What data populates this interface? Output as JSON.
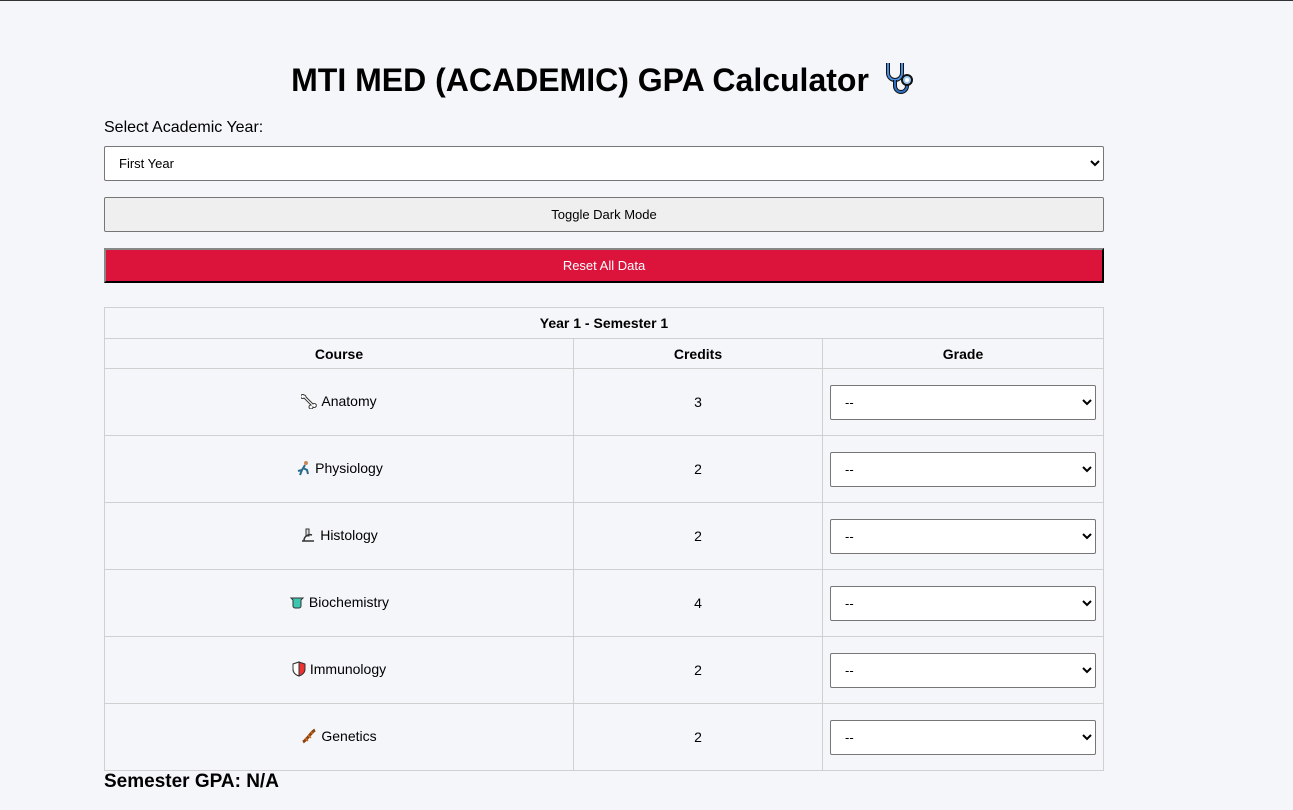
{
  "title": "MTI MED (ACADEMIC) GPA Calculator",
  "title_icon": "stethoscope-icon",
  "year_select": {
    "label": "Select Academic Year:",
    "selected": "First Year"
  },
  "buttons": {
    "toggle_dark_mode": "Toggle Dark Mode",
    "reset_all": "Reset All Data",
    "reset_color": "#dc143c"
  },
  "semester": {
    "title": "Year 1 - Semester 1",
    "columns": [
      "Course",
      "Credits",
      "Grade"
    ],
    "courses": [
      {
        "name": "Anatomy",
        "icon": "bone-icon",
        "credits": "3",
        "grade": "--"
      },
      {
        "name": "Physiology",
        "icon": "running-figure-icon",
        "credits": "2",
        "grade": "--"
      },
      {
        "name": "Histology",
        "icon": "microscope-icon",
        "credits": "2",
        "grade": "--"
      },
      {
        "name": "Biochemistry",
        "icon": "flask-icon",
        "credits": "4",
        "grade": "--"
      },
      {
        "name": "Immunology",
        "icon": "shield-icon",
        "credits": "2",
        "grade": "--"
      },
      {
        "name": "Genetics",
        "icon": "dna-icon",
        "credits": "2",
        "grade": "--"
      }
    ]
  },
  "gpa": {
    "text": "Semester GPA: N/A"
  }
}
